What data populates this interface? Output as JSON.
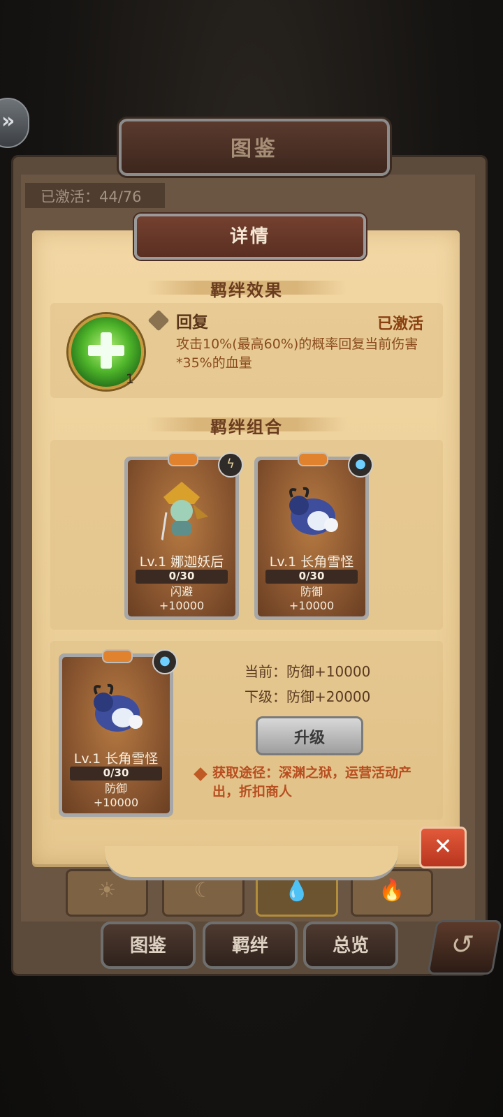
{
  "header": {
    "title": "图鉴",
    "activated": "已激活：44/76",
    "back_icon": "double-chevron-left-icon"
  },
  "detail": {
    "title": "详情",
    "effect_section": "羁绊效果",
    "skill": {
      "name": "回复",
      "level": "1",
      "status": "已激活",
      "description": "攻击10%(最高60%)的概率回复当前伤害*35%的血量",
      "icon": "heal-plus-icon"
    },
    "combo_section": "羁绊组合",
    "cards": [
      {
        "name": "Lv.1 娜迦妖后",
        "progress": "0/30",
        "stat_name": "闪避",
        "stat_value": "+10000",
        "element_icon": "lightning-icon"
      },
      {
        "name": "Lv.1 长角雪怪",
        "progress": "0/30",
        "stat_name": "防御",
        "stat_value": "+10000",
        "element_icon": "water-drop-icon"
      }
    ],
    "selected_card": {
      "name": "Lv.1 长角雪怪",
      "progress": "0/30",
      "stat_name": "防御",
      "stat_value": "+10000",
      "element_icon": "water-drop-icon"
    },
    "current": "当前：防御+10000",
    "next": "下级：防御+20000",
    "upgrade_label": "升级",
    "source": "获取途径：深渊之狱，运营活动产出，折扣商人",
    "close_icon": "close-icon"
  },
  "element_filters": [
    "☀",
    "☾",
    "💧",
    "🔥"
  ],
  "bottom_tabs": [
    "图鉴",
    "羁绊",
    "总览"
  ],
  "colors": {
    "parchment": "#ecd099",
    "accent_text": "#8a4a1c",
    "close": "#d2462c"
  }
}
